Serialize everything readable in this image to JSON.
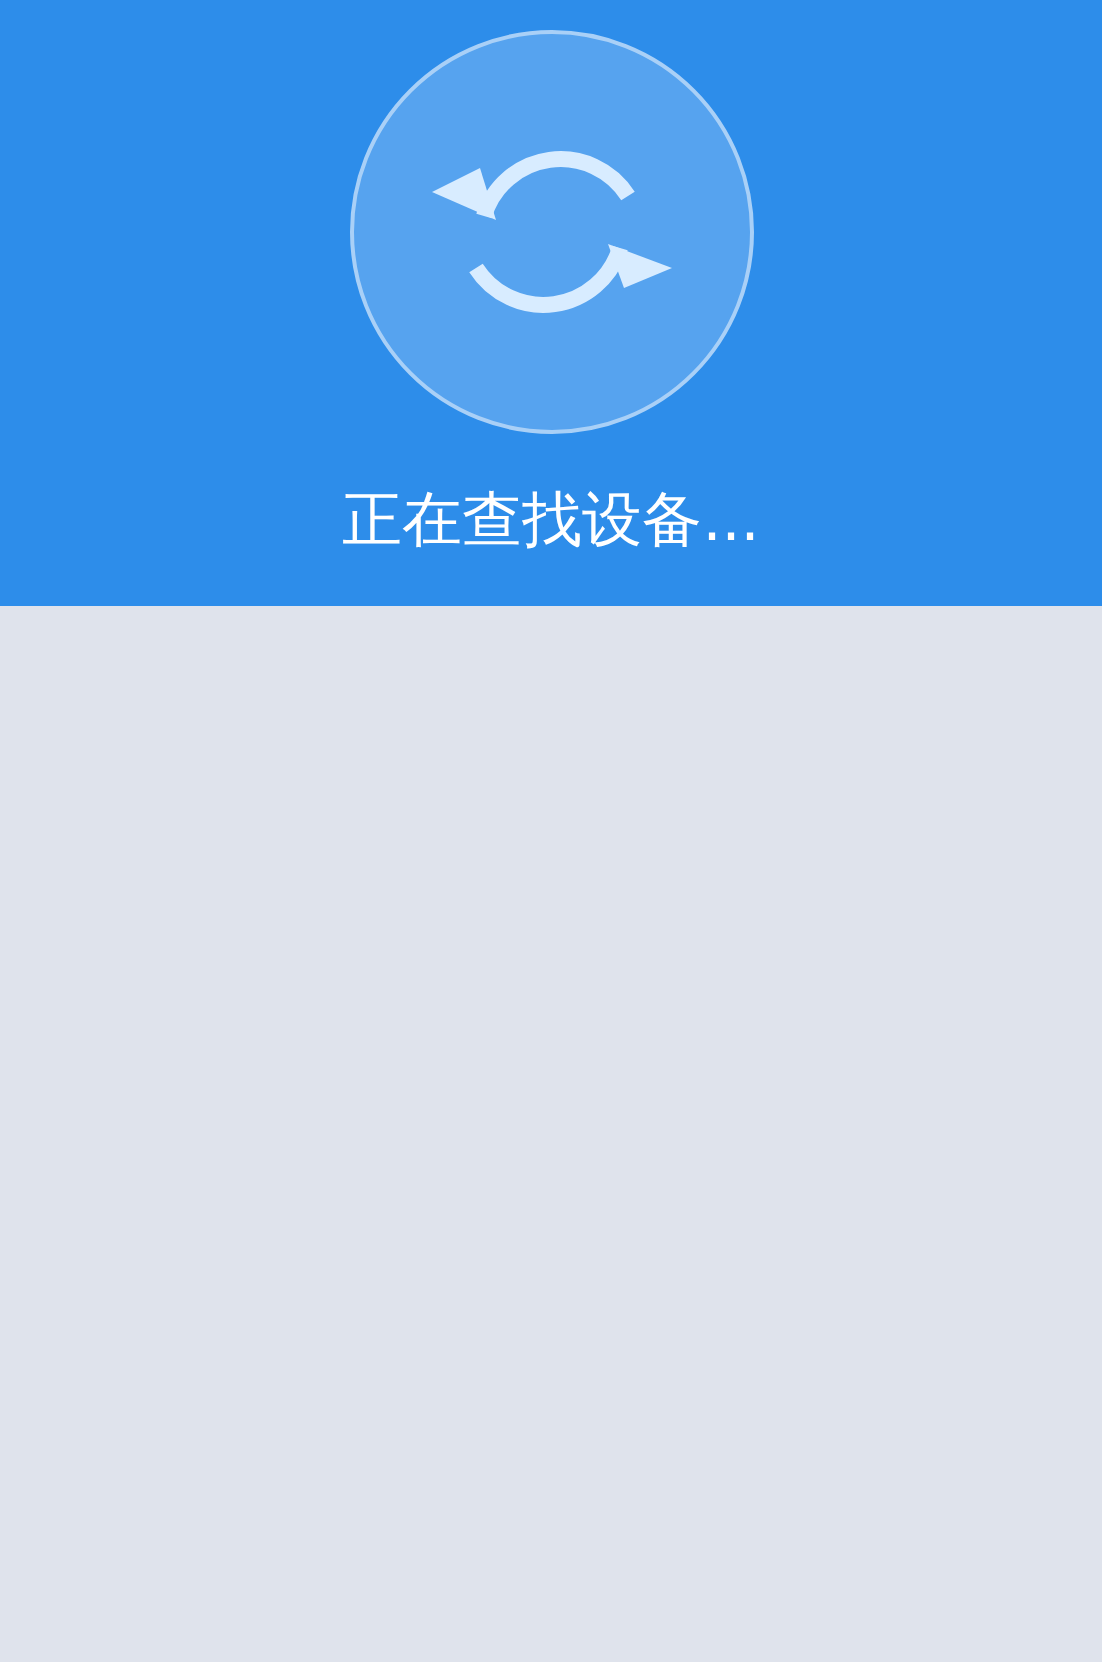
{
  "header": {
    "status_text": "正在查找设备..."
  }
}
